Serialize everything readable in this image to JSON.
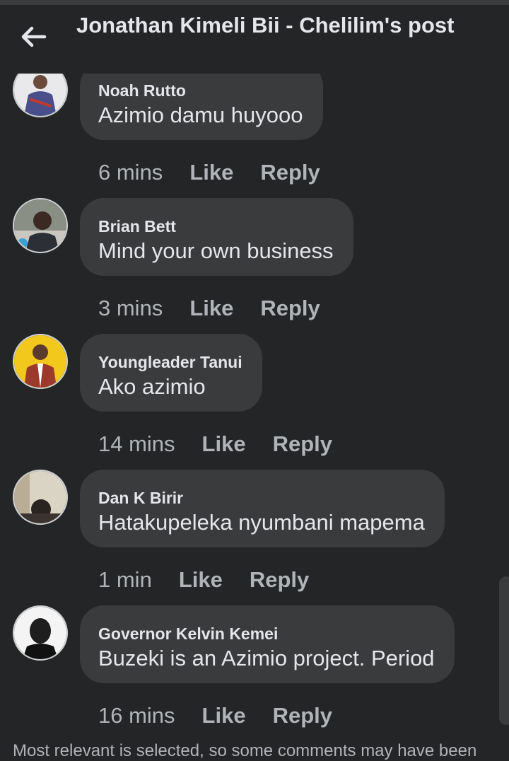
{
  "header": {
    "title": "Jonathan Kimeli Bii - Chelilim's post",
    "back_icon": "arrow-left-icon"
  },
  "comments": [
    {
      "author": "Noah Rutto",
      "text": "Azimio damu huyooo",
      "time": "6 mins",
      "like": "Like",
      "reply": "Reply"
    },
    {
      "author": "Brian Bett",
      "text": "Mind your own business",
      "time": "3 mins",
      "like": "Like",
      "reply": "Reply"
    },
    {
      "author": "Youngleader Tanui",
      "text": "Ako azimio",
      "time": "14 mins",
      "like": "Like",
      "reply": "Reply"
    },
    {
      "author": "Dan K Birir",
      "text": "Hatakupeleka nyumbani mapema",
      "time": "1 min",
      "like": "Like",
      "reply": "Reply"
    },
    {
      "author": "Governor Kelvin Kemei",
      "text": "Buzeki is an Azimio project. Period",
      "time": "16 mins",
      "like": "Like",
      "reply": "Reply"
    }
  ],
  "footer": {
    "notice": "Most relevant is selected, so some comments may have been"
  },
  "colors": {
    "background": "#242526",
    "bubble": "#3a3b3c",
    "primary_text": "#e4e6eb",
    "secondary_text": "#b0b3b8"
  }
}
